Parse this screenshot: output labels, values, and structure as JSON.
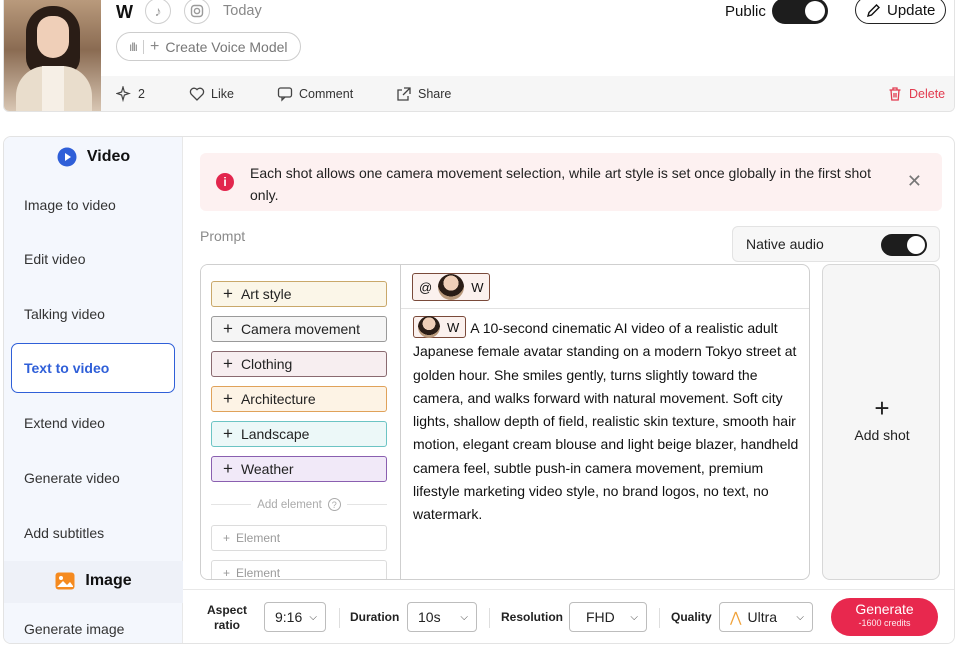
{
  "profile": {
    "name": "W",
    "date": "Today",
    "public_label": "Public",
    "update_label": "Update",
    "create_voice_label": "Create Voice Model",
    "actions": {
      "sparkle_count": "2",
      "like": "Like",
      "comment": "Comment",
      "share": "Share",
      "delete": "Delete"
    }
  },
  "sidebar": {
    "video_header": "Video",
    "video_items": [
      "Image to video",
      "Edit video",
      "Talking video",
      "Text to video",
      "Extend video",
      "Generate video",
      "Add subtitles"
    ],
    "active_item": "Text to video",
    "image_header": "Image",
    "image_items": [
      "Generate image"
    ]
  },
  "alert": {
    "text": "Each shot allows one camera movement selection, while art style is set once globally in the first shot only."
  },
  "prompt": {
    "label": "Prompt",
    "native_audio_label": "Native audio",
    "native_audio_on": true,
    "elements": [
      {
        "label": "Art style",
        "border": "#c9a86a",
        "bg": "#fbf6e8"
      },
      {
        "label": "Camera movement",
        "border": "#9a9a9a",
        "bg": "#f5f5f5"
      },
      {
        "label": "Clothing",
        "border": "#8a6a70",
        "bg": "#f7eef0"
      },
      {
        "label": "Architecture",
        "border": "#e0a25a",
        "bg": "#fdf3e5"
      },
      {
        "label": "Landscape",
        "border": "#6cc4c4",
        "bg": "#ecf8f8"
      },
      {
        "label": "Weather",
        "border": "#8a5fb0",
        "bg": "#f1e9f8"
      }
    ],
    "add_element_label": "Add element",
    "element_placeholder": "Element",
    "mention_at": "@",
    "mention_name": "W",
    "text": "A 10-second cinematic AI video of a realistic adult Japanese female avatar standing on a modern Tokyo street at golden hour. She smiles gently, turns slightly toward the camera, and walks forward with natural movement. Soft city lights, shallow depth of field, realistic skin texture, smooth hair motion, elegant cream blouse and light beige blazer, handheld camera feel, subtle push-in camera movement, premium lifestyle marketing video style, no brand logos, no text, no watermark.",
    "add_shot_label": "Add shot"
  },
  "settings": {
    "aspect_label": "Aspect ratio",
    "aspect_value": "9:16",
    "duration_label": "Duration",
    "duration_value": "10s",
    "resolution_label": "Resolution",
    "resolution_value": "FHD",
    "quality_label": "Quality",
    "quality_value": "Ultra",
    "generate_label": "Generate",
    "generate_credits": "-1600 credits"
  },
  "colors": {
    "accent_blue": "#2f5fd8",
    "generate_red": "#e8284e",
    "delete_red": "#e23b4f"
  }
}
